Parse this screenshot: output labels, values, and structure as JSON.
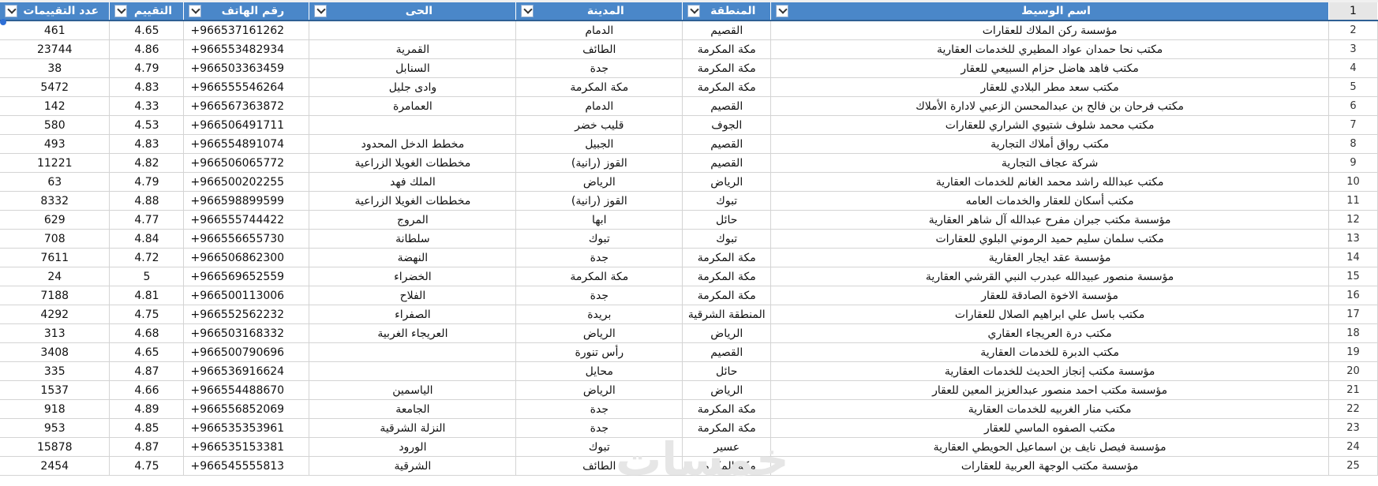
{
  "columns": {
    "count": "عدد التقييمات",
    "rating": "التقييم",
    "phone": "رقم الهاتف",
    "district": "الحى",
    "city": "المدينة",
    "region": "المنطقة",
    "name": "اسم الوسيط",
    "header_row_number": "1"
  },
  "watermark": "خمسات",
  "rows": [
    {
      "n": "2",
      "count": "461",
      "rating": "4.65",
      "phone": "+966537161262",
      "district": "",
      "city": "الدمام",
      "region": "القصيم",
      "name": "مؤسسة ركن الملاك للعقارات"
    },
    {
      "n": "3",
      "count": "23744",
      "rating": "4.86",
      "phone": "+966553482934",
      "district": "القمرية",
      "city": "الطائف",
      "region": "مكة المكرمة",
      "name": "مكتب نحا حمدان عواد المطيري للخدمات العقارية"
    },
    {
      "n": "4",
      "count": "38",
      "rating": "4.79",
      "phone": "+966503363459",
      "district": "السنابل",
      "city": "جدة",
      "region": "مكة المكرمة",
      "name": "مكتب فاهد هاضل حزام السبيعي للعقار"
    },
    {
      "n": "5",
      "count": "5472",
      "rating": "4.83",
      "phone": "+966555546264",
      "district": "وادى جليل",
      "city": "مكة المكرمة",
      "region": "مكة المكرمة",
      "name": "مكتب سعد مطر البلادي للعقار"
    },
    {
      "n": "6",
      "count": "142",
      "rating": "4.33",
      "phone": "+966567363872",
      "district": "العمامرة",
      "city": "الدمام",
      "region": "القصيم",
      "name": "مكتب فرحان بن فالح بن عبدالمحسن الزعبي لادارة الأملاك"
    },
    {
      "n": "7",
      "count": "580",
      "rating": "4.53",
      "phone": "+966506491711",
      "district": "",
      "city": "قليب خضر",
      "region": "الجوف",
      "name": "مكتب محمد شلوف شتيوي الشراري للعقارات"
    },
    {
      "n": "8",
      "count": "493",
      "rating": "4.83",
      "phone": "+966554891074",
      "district": "مخطط الدخل المحدود",
      "city": "الجبيل",
      "region": "القصيم",
      "name": "مكتب رواق أملاك التجارية"
    },
    {
      "n": "9",
      "count": "11221",
      "rating": "4.82",
      "phone": "+966506065772",
      "district": "مخططات الغويلا الزراعية",
      "city": "القوز (رانية)",
      "region": "القصيم",
      "name": "شركة عجاف التجارية"
    },
    {
      "n": "10",
      "count": "63",
      "rating": "4.79",
      "phone": "+966500202255",
      "district": "الملك فهد",
      "city": "الرياض",
      "region": "الرياض",
      "name": "مكتب عبدالله راشد محمد الغانم للخدمات العقارية"
    },
    {
      "n": "11",
      "count": "8332",
      "rating": "4.88",
      "phone": "+966598899599",
      "district": "مخططات الغويلا الزراعية",
      "city": "القوز (رانية)",
      "region": "تبوك",
      "name": "مكتب أسكان للعقار والخدمات العامه"
    },
    {
      "n": "12",
      "count": "629",
      "rating": "4.77",
      "phone": "+966555744422",
      "district": "المروج",
      "city": "ابها",
      "region": "حائل",
      "name": "مؤسسة مكتب جبران مفرح عبدالله آل شاهر العقارية"
    },
    {
      "n": "13",
      "count": "708",
      "rating": "4.84",
      "phone": "+966556655730",
      "district": "سلطانة",
      "city": "تبوك",
      "region": "تبوك",
      "name": "مكتب سلمان سليم حميد الرموني البلوي للعقارات"
    },
    {
      "n": "14",
      "count": "7611",
      "rating": "4.72",
      "phone": "+966506862300",
      "district": "النهضة",
      "city": "جدة",
      "region": "مكة المكرمة",
      "name": "مؤسسة عقد ايجار العقارية"
    },
    {
      "n": "15",
      "count": "24",
      "rating": "5",
      "phone": "+966569652559",
      "district": "الخضراء",
      "city": "مكة المكرمة",
      "region": "مكة المكرمة",
      "name": "مؤسسة منصور عبيدالله عبدرب النبي القرشي العقارية"
    },
    {
      "n": "16",
      "count": "7188",
      "rating": "4.81",
      "phone": "+966500113006",
      "district": "الفلاح",
      "city": "جدة",
      "region": "مكة المكرمة",
      "name": "مؤسسة الاخوة الصادقة للعقار"
    },
    {
      "n": "17",
      "count": "4292",
      "rating": "4.75",
      "phone": "+966552562232",
      "district": "الصفراء",
      "city": "بريدة",
      "region": "المنطقة الشرقية",
      "name": "مكتب باسل علي ابراهيم الصلال للعقارات"
    },
    {
      "n": "18",
      "count": "313",
      "rating": "4.68",
      "phone": "+966503168332",
      "district": "العريجاء الغربية",
      "city": "الرياض",
      "region": "الرياض",
      "name": "مكتب درة العريجاء العقاري"
    },
    {
      "n": "19",
      "count": "3408",
      "rating": "4.65",
      "phone": "+966500790696",
      "district": "",
      "city": "رأس تنورة",
      "region": "القصيم",
      "name": "مكتب الدبرة للخدمات العقارية"
    },
    {
      "n": "20",
      "count": "335",
      "rating": "4.87",
      "phone": "+966536916624",
      "district": "",
      "city": "محايل",
      "region": "حائل",
      "name": "مؤسسة مكتب إنجاز الحديث للخدمات العقارية"
    },
    {
      "n": "21",
      "count": "1537",
      "rating": "4.66",
      "phone": "+966554488670",
      "district": "الياسمين",
      "city": "الرياض",
      "region": "الرياض",
      "name": "مؤسسة مكتب احمد منصور عبدالعزيز المعين للعقار"
    },
    {
      "n": "22",
      "count": "918",
      "rating": "4.89",
      "phone": "+966556852069",
      "district": "الجامعة",
      "city": "جدة",
      "region": "مكة المكرمة",
      "name": "مكتب منار الغربيه للخدمات العقارية"
    },
    {
      "n": "23",
      "count": "953",
      "rating": "4.85",
      "phone": "+966535353961",
      "district": "النزلة الشرقية",
      "city": "جدة",
      "region": "مكة المكرمة",
      "name": "مكتب الصفوه الماسي للعقار"
    },
    {
      "n": "24",
      "count": "15878",
      "rating": "4.87",
      "phone": "+966535153381",
      "district": "الورود",
      "city": "تبوك",
      "region": "عسير",
      "name": "مؤسسة فيصل نايف بن اسماعيل الحويطي العقارية"
    },
    {
      "n": "25",
      "count": "2454",
      "rating": "4.75",
      "phone": "+966545555813",
      "district": "الشرقية",
      "city": "الطائف",
      "region": "مكة المكرمة",
      "name": "مؤسسة مكتب الوجهة العربية للعقارات"
    }
  ]
}
